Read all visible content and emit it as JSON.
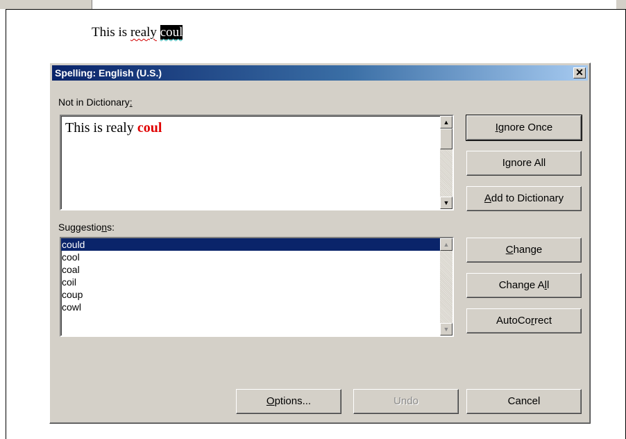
{
  "document": {
    "text_before": "This is ",
    "misspelled_word": "realy",
    "space": " ",
    "selected_word": "coul"
  },
  "dialog": {
    "title": "Spelling: English (U.S.)",
    "close_label": "✕",
    "not_in_dictionary": {
      "label_main": "Not in Dictionary",
      "label_accel": ":",
      "text_prefix": "This is realy ",
      "error_word": "coul"
    },
    "suggestions": {
      "label_pre": "Suggestio",
      "label_accel": "n",
      "label_post": "s:",
      "items": [
        "could",
        "cool",
        "coal",
        "coil",
        "coup",
        "cowl"
      ],
      "selected_index": 0
    },
    "buttons": {
      "ignore_once": {
        "accel": "I",
        "rest": "gnore Once"
      },
      "ignore_all": {
        "pre": "I",
        "accel": "g",
        "rest": "nore All"
      },
      "add_to_dictionary": {
        "accel": "A",
        "rest": "dd to Dictionary"
      },
      "change": {
        "accel": "C",
        "rest": "hange"
      },
      "change_all": {
        "pre": "Change A",
        "accel": "l",
        "rest": "l"
      },
      "autocorrect": {
        "pre": "AutoCo",
        "accel": "r",
        "rest": "rect"
      },
      "options": {
        "accel": "O",
        "rest": "ptions..."
      },
      "undo": "Undo",
      "cancel": "Cancel"
    },
    "scroll_arrows": {
      "up": "▲",
      "down": "▼"
    }
  }
}
